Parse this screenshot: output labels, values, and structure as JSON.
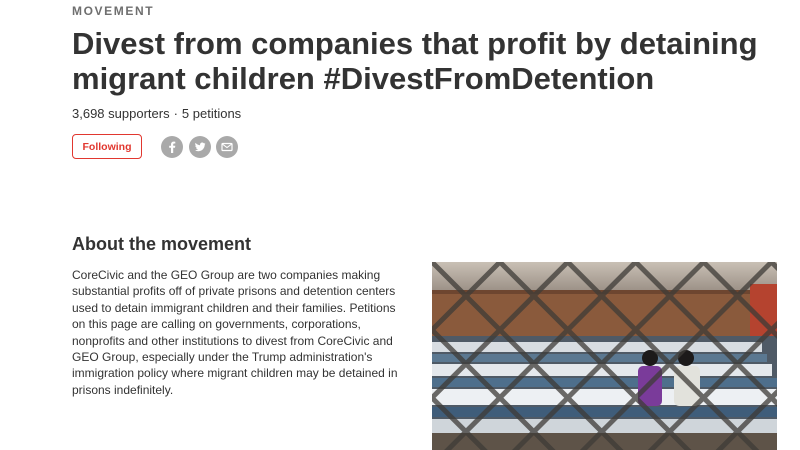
{
  "kicker": "MOVEMENT",
  "headline": "Divest from companies that profit by detaining migrant children #DivestFromDetention",
  "meta": {
    "supporters": "3,698 supporters",
    "separator": "·",
    "petitions": "5 petitions"
  },
  "actions": {
    "follow_label": "Following",
    "share_icons": [
      "facebook-icon",
      "twitter-icon",
      "email-icon"
    ]
  },
  "about": {
    "title": "About the movement",
    "body": "CoreCivic and the GEO Group are two companies making substantial profits off of private prisons and detention centers used to detain immigrant children and their families. Petitions on this page are calling on governments, corporations, nonprofits and other institutions to divest from CoreCivic and GEO Group, especially under the Trump administration's immigration policy where migrant children may be detained in prisons indefinitely."
  },
  "colors": {
    "accent": "#e1372f",
    "text": "#333333",
    "kicker": "#6f6f6f",
    "icon_bg": "#a9a9a9"
  }
}
